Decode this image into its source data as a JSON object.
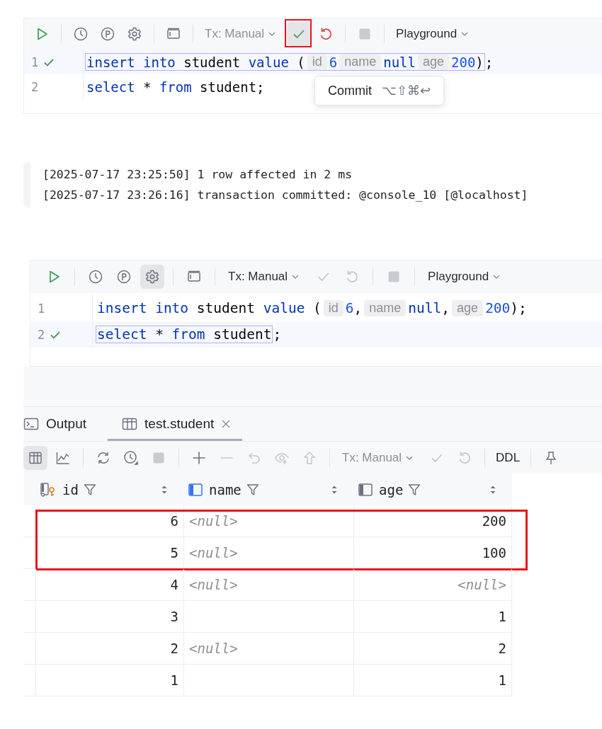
{
  "editor_top": {
    "toolbar": [
      {
        "kind": "run",
        "disabled": false,
        "selected": false,
        "highlighted": false
      },
      {
        "kind": "separator"
      },
      {
        "kind": "history",
        "disabled": false,
        "selected": false,
        "highlighted": false
      },
      {
        "kind": "params",
        "disabled": false,
        "selected": false,
        "highlighted": false
      },
      {
        "kind": "settings",
        "disabled": false,
        "selected": false,
        "highlighted": false
      },
      {
        "kind": "separator"
      },
      {
        "kind": "layout",
        "disabled": false,
        "selected": false,
        "highlighted": false
      },
      {
        "kind": "separator"
      },
      {
        "kind": "dropdown",
        "label": "Tx: Manual",
        "disabled": true
      },
      {
        "kind": "commit",
        "disabled": false,
        "selected": true,
        "highlighted": true
      },
      {
        "kind": "rollback",
        "disabled": false,
        "selected": false,
        "highlighted": false
      },
      {
        "kind": "separator"
      },
      {
        "kind": "stop",
        "disabled": true,
        "selected": false,
        "highlighted": false
      },
      {
        "kind": "separator"
      },
      {
        "kind": "dropdown",
        "label": "Playground",
        "disabled": false
      }
    ],
    "lines": [
      {
        "number": "1",
        "executed": true,
        "current": true,
        "tokens": [
          {
            "kind": "keyword",
            "text": "insert",
            "gap": true
          },
          {
            "kind": "keyword",
            "text": "into",
            "gap": true
          },
          {
            "kind": "ident",
            "text": "student",
            "gap": true
          },
          {
            "kind": "keyword",
            "text": "value",
            "gap": true
          },
          {
            "kind": "punct",
            "text": "(",
            "gap": false
          },
          {
            "kind": "hint",
            "text": "id",
            "gap": false
          },
          {
            "kind": "number",
            "text": "6",
            "gap": false
          },
          {
            "kind": "hint",
            "text": "name",
            "gap": false
          },
          {
            "kind": "keyword",
            "text": "null",
            "gap": false
          },
          {
            "kind": "hint",
            "text": "age",
            "gap": false
          },
          {
            "kind": "number",
            "text": "200",
            "gap": false
          },
          {
            "kind": "punct",
            "text": ")",
            "gap": false
          }
        ],
        "after": [
          {
            "kind": "punct",
            "text": ";"
          }
        ]
      },
      {
        "number": "2",
        "executed": false,
        "current": false,
        "tokens": [
          {
            "kind": "keyword",
            "text": "select",
            "gap": true
          },
          {
            "kind": "ident",
            "text": "*",
            "gap": true
          },
          {
            "kind": "keyword",
            "text": "from",
            "gap": true
          },
          {
            "kind": "ident",
            "text": "student",
            "gap": false
          },
          {
            "kind": "punct",
            "text": ";",
            "gap": false
          }
        ]
      }
    ],
    "tooltip": {
      "label": "Commit",
      "shortcut": "⌥⇧⌘↩"
    }
  },
  "console": [
    "[2025-07-17 23:25:50] 1 row affected in 2 ms",
    "[2025-07-17 23:26:16] transaction committed: @console_10 [@localhost]"
  ],
  "editor_bottom": {
    "toolbar": [
      {
        "kind": "run",
        "disabled": false,
        "selected": false,
        "highlighted": false
      },
      {
        "kind": "separator"
      },
      {
        "kind": "history",
        "disabled": false,
        "selected": false,
        "highlighted": false
      },
      {
        "kind": "params",
        "disabled": false,
        "selected": false,
        "highlighted": false
      },
      {
        "kind": "settings",
        "disabled": false,
        "selected": true,
        "highlighted": false
      },
      {
        "kind": "separator"
      },
      {
        "kind": "layout",
        "disabled": false,
        "selected": false,
        "highlighted": false
      },
      {
        "kind": "separator"
      },
      {
        "kind": "dropdown",
        "label": "Tx: Manual",
        "disabled": false
      },
      {
        "kind": "commit",
        "disabled": true,
        "selected": false,
        "highlighted": false
      },
      {
        "kind": "rollback",
        "disabled": true,
        "selected": false,
        "highlighted": false
      },
      {
        "kind": "separator"
      },
      {
        "kind": "stop",
        "disabled": true,
        "selected": false,
        "highlighted": false
      },
      {
        "kind": "separator"
      },
      {
        "kind": "dropdown",
        "label": "Playground",
        "disabled": false
      }
    ],
    "lines": [
      {
        "number": "1",
        "executed": false,
        "current": false,
        "tokens": [
          {
            "kind": "keyword",
            "text": "insert",
            "gap": true
          },
          {
            "kind": "keyword",
            "text": "into",
            "gap": true
          },
          {
            "kind": "ident",
            "text": "student",
            "gap": true
          },
          {
            "kind": "keyword",
            "text": "value",
            "gap": true
          },
          {
            "kind": "punct",
            "text": "(",
            "gap": false
          },
          {
            "kind": "hint",
            "text": "id",
            "gap": false
          },
          {
            "kind": "number",
            "text": "6",
            "gap": false
          },
          {
            "kind": "punct",
            "text": ",",
            "gap": false
          },
          {
            "kind": "hint",
            "text": "name",
            "gap": false
          },
          {
            "kind": "keyword",
            "text": "null",
            "gap": false
          },
          {
            "kind": "punct",
            "text": ",",
            "gap": false
          },
          {
            "kind": "hint",
            "text": "age",
            "gap": false
          },
          {
            "kind": "number",
            "text": "200",
            "gap": false
          },
          {
            "kind": "punct",
            "text": ");",
            "gap": false
          }
        ]
      },
      {
        "number": "2",
        "executed": true,
        "current": true,
        "tokens": [
          {
            "kind": "keyword",
            "text": "select",
            "gap": true
          },
          {
            "kind": "ident",
            "text": "*",
            "gap": true
          },
          {
            "kind": "keyword",
            "text": "from",
            "gap": true
          },
          {
            "kind": "ident",
            "text": "student",
            "gap": false
          }
        ],
        "after": [
          {
            "kind": "punct",
            "text": ";"
          }
        ]
      }
    ]
  },
  "results": {
    "tabs": [
      {
        "label": "Output",
        "kind": "terminal",
        "selected": false,
        "closable": false
      },
      {
        "label": "test.student",
        "kind": "table",
        "selected": true,
        "closable": true
      }
    ],
    "toolbar": [
      {
        "kind": "grid",
        "disabled": false,
        "selected": true
      },
      {
        "kind": "chart",
        "disabled": false,
        "selected": false
      },
      {
        "kind": "separator"
      },
      {
        "kind": "refresh",
        "disabled": false,
        "selected": false
      },
      {
        "kind": "history",
        "disabled": false,
        "selected": false
      },
      {
        "kind": "stop",
        "disabled": true,
        "selected": false
      },
      {
        "kind": "separator"
      },
      {
        "kind": "add",
        "disabled": false,
        "selected": false
      },
      {
        "kind": "remove",
        "disabled": true,
        "selected": false
      },
      {
        "kind": "revert",
        "disabled": true,
        "selected": false
      },
      {
        "kind": "view",
        "disabled": true,
        "selected": false
      },
      {
        "kind": "submit",
        "disabled": true,
        "selected": false
      },
      {
        "kind": "separator"
      },
      {
        "kind": "dropdown",
        "label": "Tx: Manual",
        "disabled": true
      },
      {
        "kind": "commit",
        "disabled": true,
        "selected": false
      },
      {
        "kind": "rollback",
        "disabled": true,
        "selected": false
      },
      {
        "kind": "separator"
      },
      {
        "kind": "text",
        "label": "DDL",
        "disabled": false
      },
      {
        "kind": "separator"
      },
      {
        "kind": "pin",
        "disabled": false,
        "selected": false
      }
    ],
    "columns": [
      {
        "name": "id",
        "kind": "numeric",
        "primary_key": true,
        "color": "#6c707e"
      },
      {
        "name": "name",
        "kind": "text",
        "primary_key": false,
        "color": "#3574f0"
      },
      {
        "name": "age",
        "kind": "numeric",
        "primary_key": false,
        "color": "#6c707e"
      }
    ],
    "rows": [
      {
        "highlighted": true,
        "cells": [
          {
            "kind": "value",
            "text": "6"
          },
          {
            "kind": "null",
            "text": "<null>"
          },
          {
            "kind": "value",
            "text": "200"
          }
        ]
      },
      {
        "highlighted": true,
        "cells": [
          {
            "kind": "value",
            "text": "5"
          },
          {
            "kind": "null",
            "text": "<null>"
          },
          {
            "kind": "value",
            "text": "100"
          }
        ]
      },
      {
        "highlighted": false,
        "cells": [
          {
            "kind": "value",
            "text": "4"
          },
          {
            "kind": "null",
            "text": "<null>"
          },
          {
            "kind": "null",
            "text": "<null>"
          }
        ]
      },
      {
        "highlighted": false,
        "cells": [
          {
            "kind": "value",
            "text": "3"
          },
          {
            "kind": "empty"
          },
          {
            "kind": "value",
            "text": "1"
          }
        ]
      },
      {
        "highlighted": false,
        "cells": [
          {
            "kind": "value",
            "text": "2"
          },
          {
            "kind": "null",
            "text": "<null>"
          },
          {
            "kind": "value",
            "text": "2"
          }
        ]
      },
      {
        "highlighted": false,
        "cells": [
          {
            "kind": "value",
            "text": "1"
          },
          {
            "kind": "empty"
          },
          {
            "kind": "value",
            "text": "1"
          }
        ]
      }
    ]
  }
}
